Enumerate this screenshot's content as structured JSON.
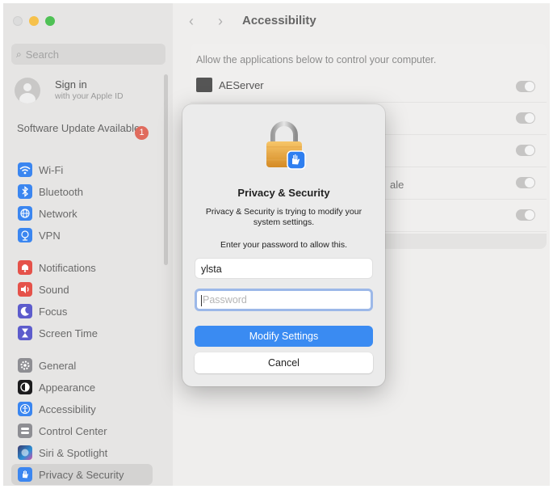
{
  "window": {
    "title": "Accessibility"
  },
  "sidebar": {
    "search_placeholder": "Search",
    "sign_in": {
      "title": "Sign in",
      "subtitle": "with your Apple ID"
    },
    "software_update": {
      "label": "Software Update Available",
      "badge": "1"
    },
    "items": [
      {
        "label": "Wi-Fi",
        "icon": "wifi-icon",
        "color": "#3b86f0"
      },
      {
        "label": "Bluetooth",
        "icon": "bluetooth-icon",
        "color": "#3b86f0"
      },
      {
        "label": "Network",
        "icon": "globe-icon",
        "color": "#3b86f0"
      },
      {
        "label": "VPN",
        "icon": "vpn-icon",
        "color": "#3b86f0"
      },
      {
        "label": "Notifications",
        "icon": "bell-icon",
        "color": "#e5524a"
      },
      {
        "label": "Sound",
        "icon": "speaker-icon",
        "color": "#e5524a"
      },
      {
        "label": "Focus",
        "icon": "moon-icon",
        "color": "#5d5ccc"
      },
      {
        "label": "Screen Time",
        "icon": "hourglass-icon",
        "color": "#5d5ccc"
      },
      {
        "label": "General",
        "icon": "gear-icon",
        "color": "#8e8e93"
      },
      {
        "label": "Appearance",
        "icon": "appearance-icon",
        "color": "#1c1c1e"
      },
      {
        "label": "Accessibility",
        "icon": "accessibility-icon",
        "color": "#3b86f0"
      },
      {
        "label": "Control Center",
        "icon": "control-center-icon",
        "color": "#8e8e93"
      },
      {
        "label": "Siri & Spotlight",
        "icon": "siri-icon",
        "color": "#7b59d6"
      },
      {
        "label": "Privacy & Security",
        "icon": "hand-icon",
        "color": "#3b86f0"
      }
    ]
  },
  "main": {
    "description": "Allow the applications below to control your computer.",
    "apps": [
      {
        "name": "AEServer"
      }
    ],
    "partial_label": "ale"
  },
  "dialog": {
    "title": "Privacy & Security",
    "message": "Privacy & Security is trying to modify your system settings.",
    "prompt": "Enter your password to allow this.",
    "username": "ylsta",
    "password_placeholder": "Password",
    "primary_button": "Modify Settings",
    "cancel_button": "Cancel"
  }
}
